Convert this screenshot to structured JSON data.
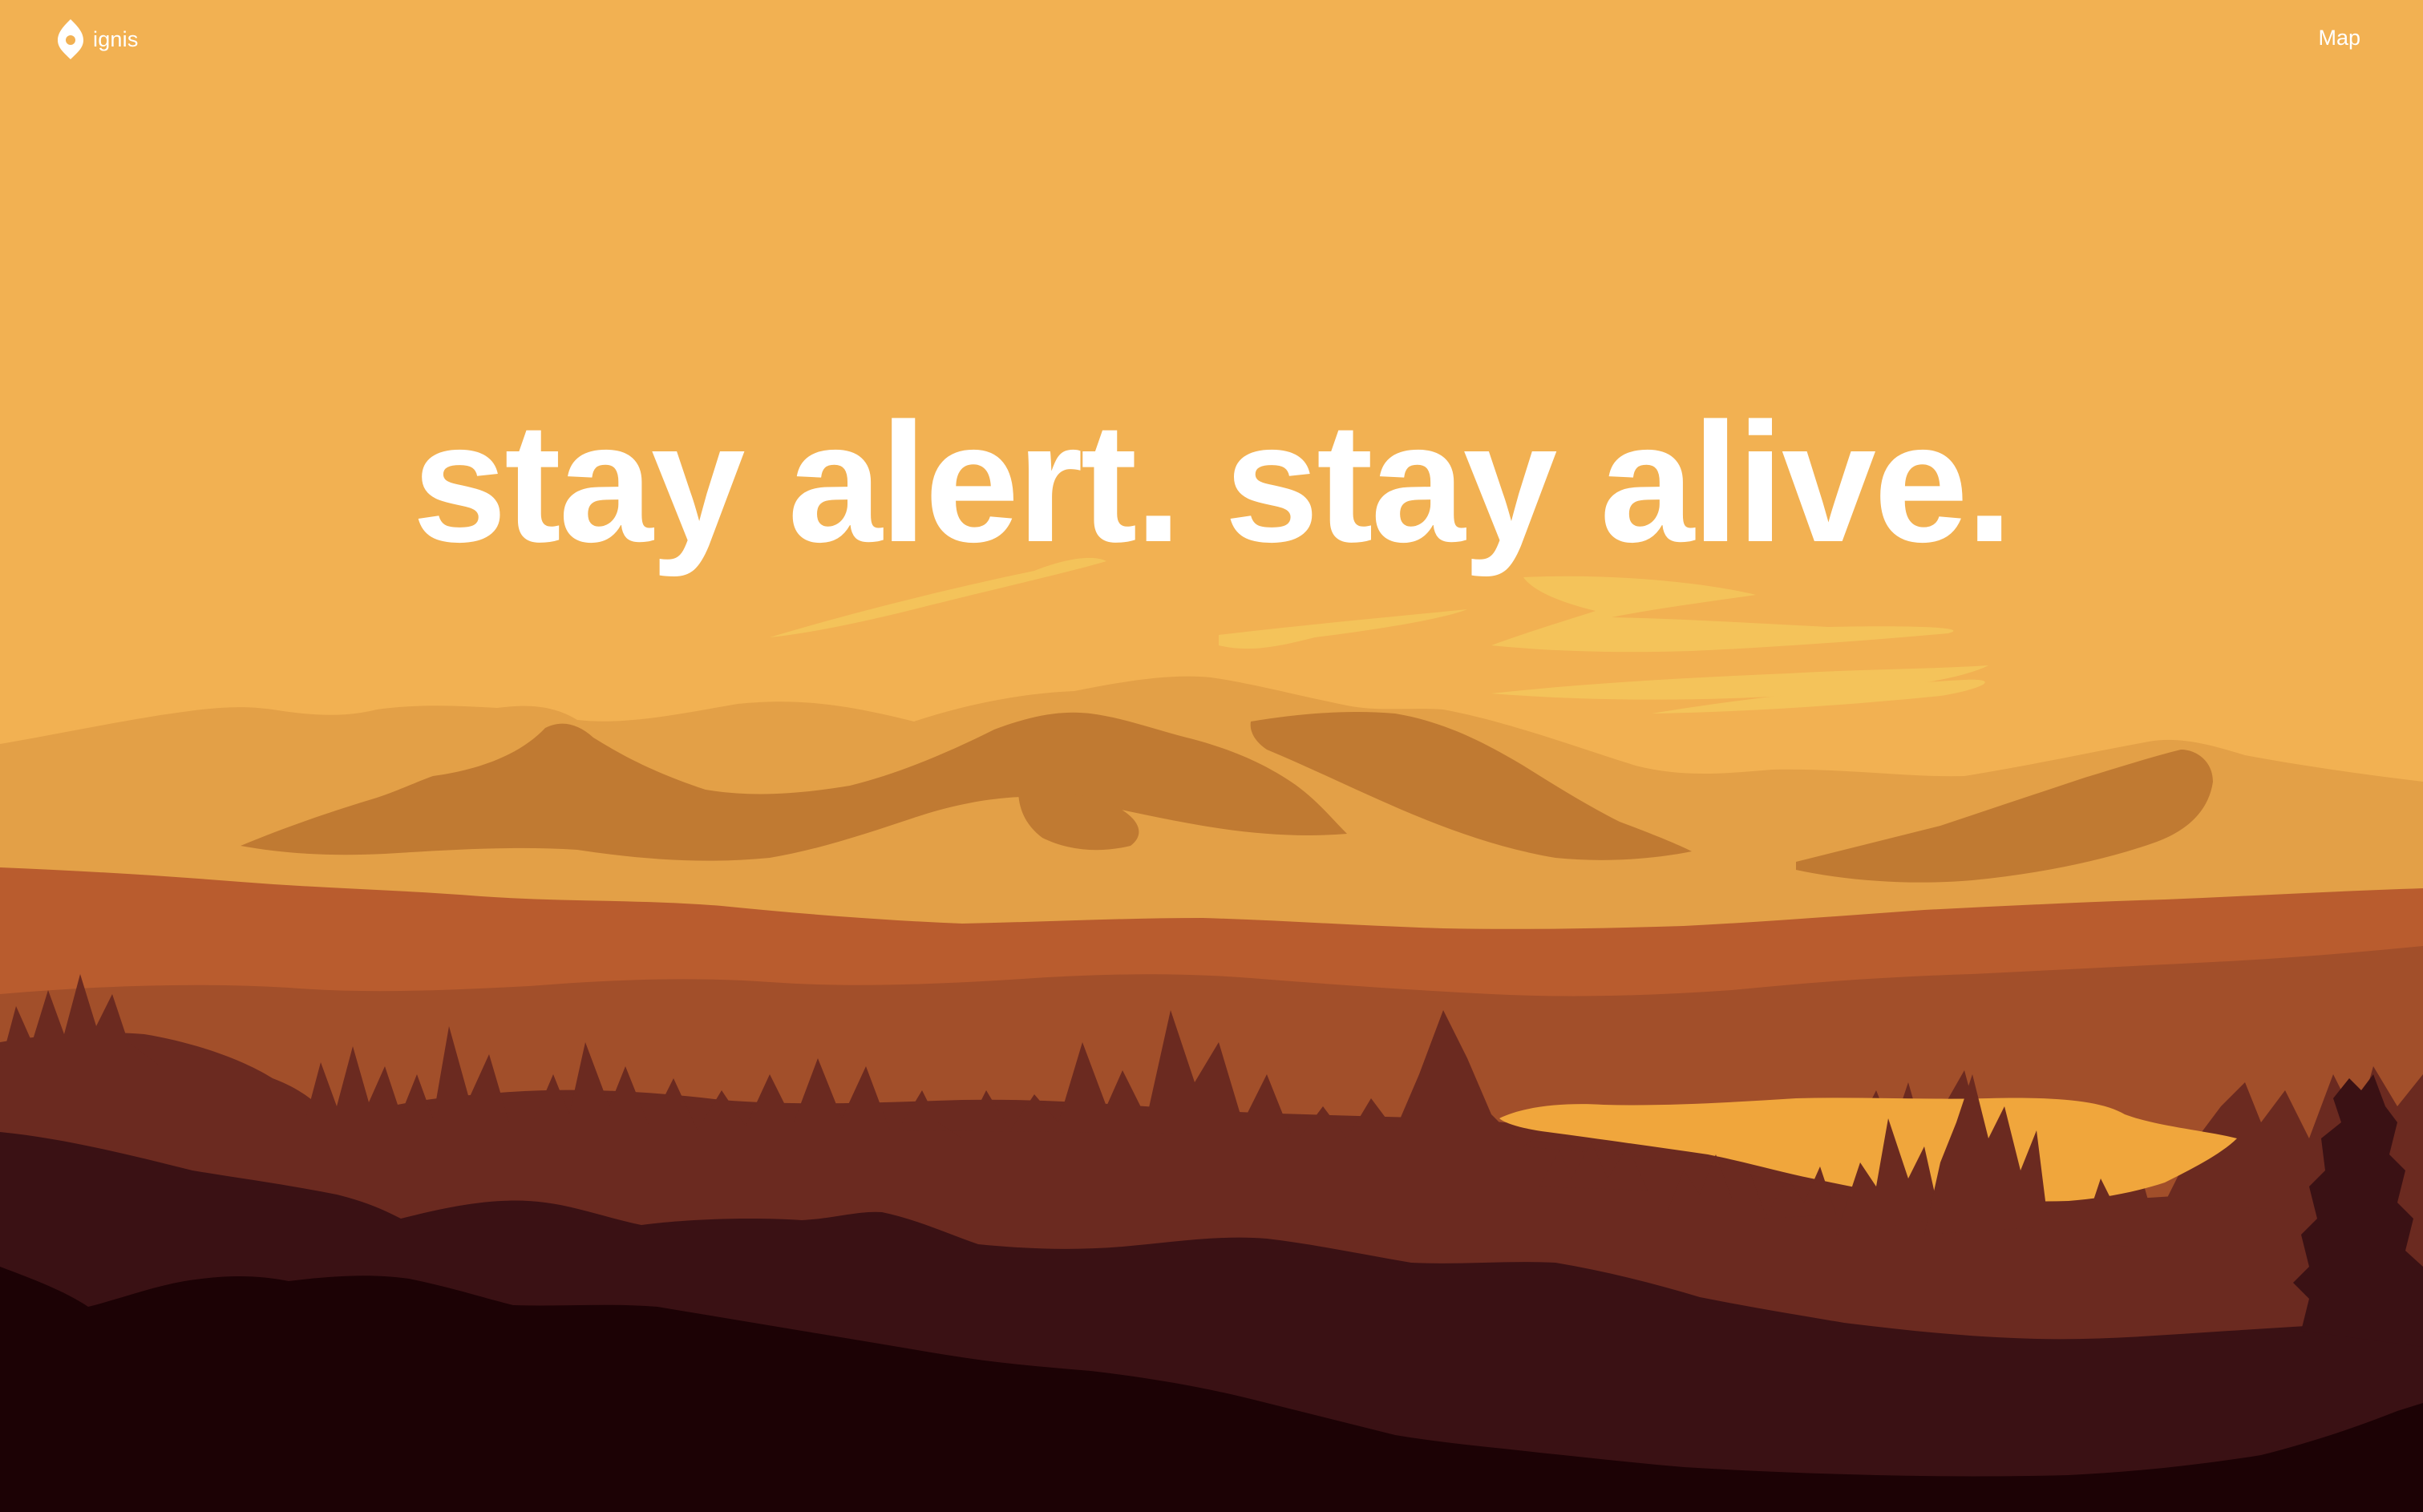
{
  "brand": {
    "name": "ignis",
    "logo_icon": "flame-pin-icon"
  },
  "nav": {
    "map_label": "Map"
  },
  "hero": {
    "headline": "stay alert. stay alive."
  },
  "palette": {
    "sky": "#f2b152",
    "cloud": "#f4c35a",
    "far_mountain": "#e3a047",
    "mountain_shadow": "#c07a32",
    "mid_ridge": "#b95c2e",
    "far_forest": "#a24f2a",
    "forest": "#6b2a20",
    "lake": "#f0a63c",
    "near_hill": "#3a1114",
    "foreground": "#1c0205"
  }
}
